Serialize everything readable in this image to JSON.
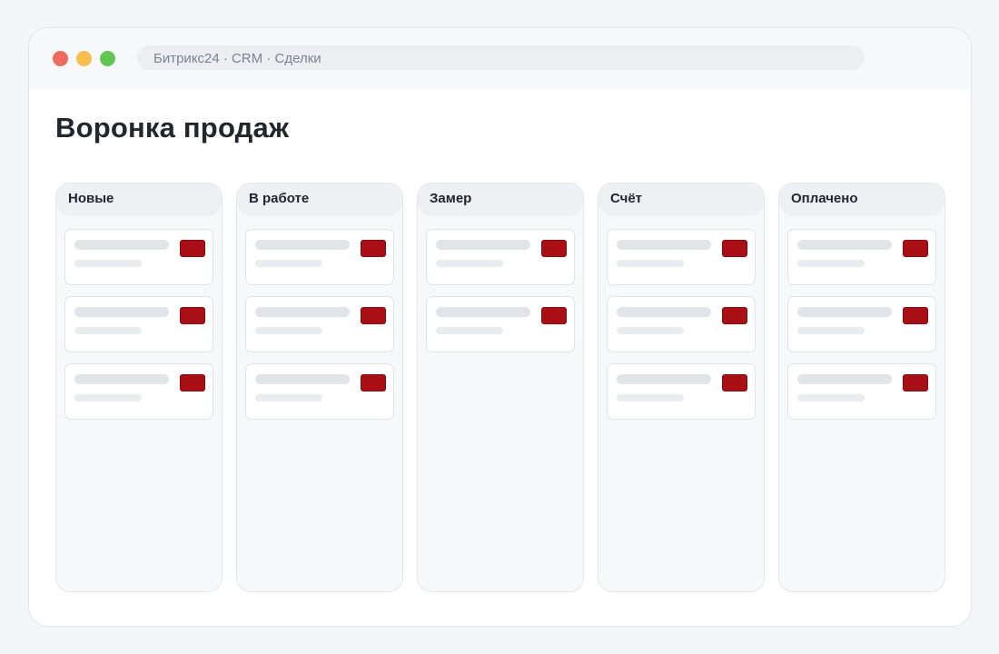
{
  "window": {
    "address": "Битрикс24 · CRM · Сделки",
    "traffic_lights": {
      "close": "#ec6a5e",
      "minimize": "#f5bf4f",
      "maximize": "#61c554"
    }
  },
  "page": {
    "title": "Воронка продаж"
  },
  "colors": {
    "tag": "#a90f15",
    "card_line": "#e2e4e8"
  },
  "board": {
    "columns": [
      {
        "title": "Новые",
        "card_count": 3
      },
      {
        "title": "В работе",
        "card_count": 3
      },
      {
        "title": "Замер",
        "card_count": 2
      },
      {
        "title": "Счёт",
        "card_count": 3
      },
      {
        "title": "Оплачено",
        "card_count": 3
      }
    ]
  }
}
